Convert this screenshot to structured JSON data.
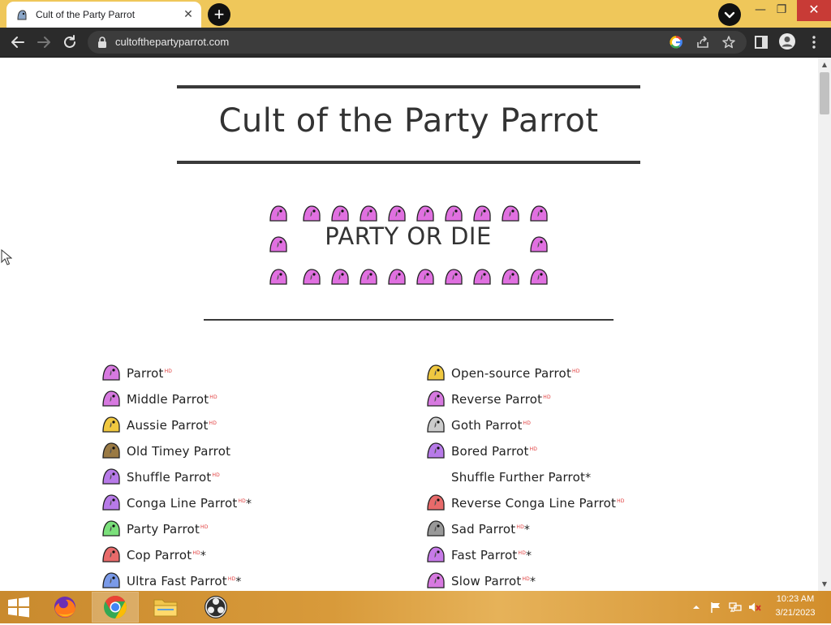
{
  "browser": {
    "tab_title": "Cult of the Party Parrot",
    "tab_close": "✕",
    "new_tab": "+",
    "url": "cultofthepartyparrot.com",
    "window": {
      "minimize": "—",
      "restore": "❐",
      "close": "✕"
    }
  },
  "page": {
    "title": "Cult of the Party Parrot",
    "banner": "PARTY OR DIE"
  },
  "parrots_left": [
    {
      "label": "Parrot",
      "hd": "HD",
      "star": "",
      "color": "#d779e0"
    },
    {
      "label": "Middle Parrot",
      "hd": "HD",
      "star": "",
      "color": "#d779e0"
    },
    {
      "label": "Aussie Parrot",
      "hd": "HD",
      "star": "",
      "color": "#f0c840"
    },
    {
      "label": "Old Timey Parrot",
      "hd": "",
      "star": "",
      "color": "#9a7a44"
    },
    {
      "label": "Shuffle Parrot",
      "hd": "HD",
      "star": "",
      "color": "#b77ae8"
    },
    {
      "label": "Conga Line Parrot",
      "hd": "HD",
      "star": "*",
      "color": "#b77ae8"
    },
    {
      "label": "Party Parrot",
      "hd": "HD",
      "star": "",
      "color": "#7be07b"
    },
    {
      "label": "Cop Parrot",
      "hd": "HD",
      "star": "*",
      "color": "#e86a6a"
    },
    {
      "label": "Ultra Fast Parrot",
      "hd": "HD",
      "star": "*",
      "color": "#7a9ae8"
    }
  ],
  "parrots_right": [
    {
      "label": "Open-source Parrot",
      "hd": "HD",
      "star": "",
      "color": "#f0c840"
    },
    {
      "label": "Reverse Parrot",
      "hd": "HD",
      "star": "",
      "color": "#d779e0"
    },
    {
      "label": "Goth Parrot",
      "hd": "HD",
      "star": "",
      "color": "#cccccc"
    },
    {
      "label": "Bored Parrot",
      "hd": "HD",
      "star": "",
      "color": "#b77ae8"
    },
    {
      "label": "Shuffle Further Parrot",
      "hd": "",
      "star": "*",
      "color": "#ffffff"
    },
    {
      "label": "Reverse Conga Line Parrot",
      "hd": "HD",
      "star": "",
      "color": "#e86a6a"
    },
    {
      "label": "Sad Parrot",
      "hd": "HD",
      "star": "*",
      "color": "#999999"
    },
    {
      "label": "Fast Parrot",
      "hd": "HD",
      "star": "*",
      "color": "#c77ae8"
    },
    {
      "label": "Slow Parrot",
      "hd": "HD",
      "star": "*",
      "color": "#d779e0"
    }
  ],
  "taskbar": {
    "time": "10:23 AM",
    "date": "3/21/2023"
  },
  "colors": {
    "titlebar": "#efc75a",
    "toolbar": "#2b2b2b",
    "banner_parrot": "#e070e0"
  }
}
